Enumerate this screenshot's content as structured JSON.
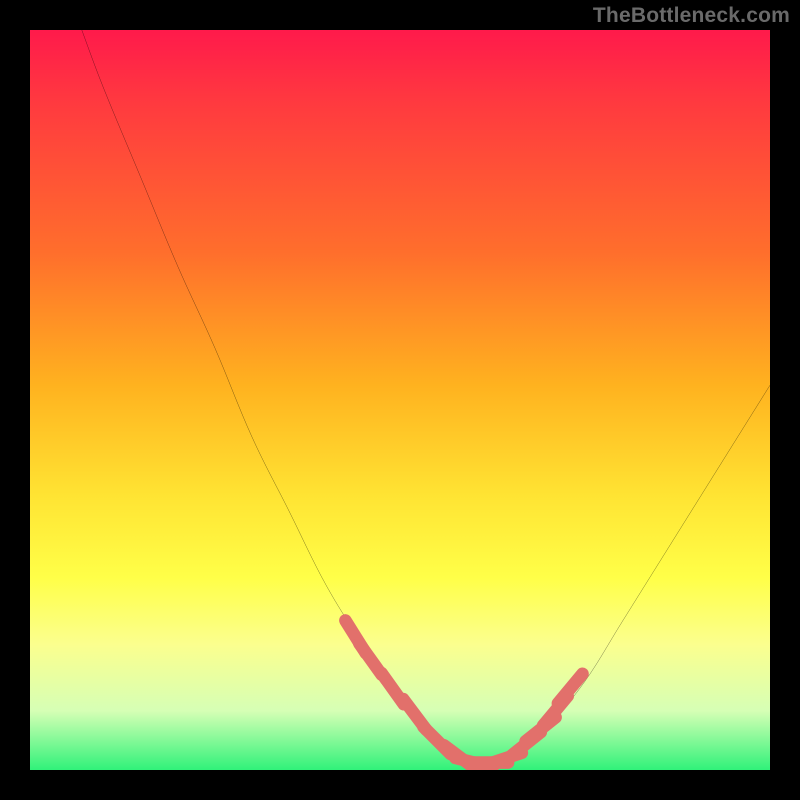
{
  "watermark": "TheBottleneck.com",
  "colors": {
    "page_bg": "#000000",
    "gradient_top": "#ff1a4b",
    "gradient_bottom": "#30f27a",
    "curve": "#000000",
    "marker": "#e2706b",
    "watermark_text": "#6a6a6a"
  },
  "chart_data": {
    "type": "line",
    "title": "",
    "xlabel": "",
    "ylabel": "",
    "xlim": [
      0,
      100
    ],
    "ylim": [
      0,
      100
    ],
    "grid": false,
    "legend": false,
    "annotations": [],
    "series": [
      {
        "name": "curve",
        "x": [
          7,
          10,
          15,
          20,
          25,
          30,
          35,
          40,
          45,
          50,
          53,
          56,
          58,
          60,
          62,
          65,
          70,
          75,
          80,
          85,
          90,
          95,
          100
        ],
        "y": [
          100,
          92,
          80,
          68,
          57,
          45,
          35,
          25,
          17,
          10,
          6,
          3,
          1.5,
          1,
          1,
          2,
          6,
          12,
          20,
          28,
          36,
          44,
          52
        ]
      },
      {
        "name": "markers",
        "x": [
          44,
          46,
          49,
          52,
          55,
          58,
          60,
          62,
          64,
          67,
          69,
          71,
          73
        ],
        "y": [
          18,
          15,
          11,
          7.5,
          4,
          1.8,
          1,
          1,
          1.5,
          3.5,
          5.5,
          8,
          11
        ]
      }
    ]
  }
}
